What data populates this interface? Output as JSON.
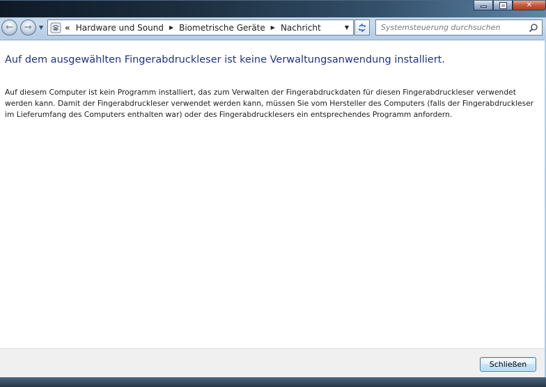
{
  "window": {
    "caption_buttons": {
      "minimize": "minimize",
      "maximize": "maximize",
      "close": "close"
    }
  },
  "navigation": {
    "back_icon": "back-arrow-icon",
    "forward_icon": "forward-arrow-icon",
    "overflow": "«",
    "breadcrumbs": [
      {
        "label": "Hardware und Sound"
      },
      {
        "label": "Biometrische Geräte"
      },
      {
        "label": "Nachricht"
      }
    ]
  },
  "search": {
    "placeholder": "Systemsteuerung durchsuchen",
    "value": ""
  },
  "content": {
    "heading": "Auf dem ausgewählten Fingerabdruckleser ist keine Verwaltungsanwendung installiert.",
    "description": "Auf diesem Computer ist kein Programm installiert, das zum Verwalten der Fingerabdruckdaten für diesen Fingerabdruckleser verwendet werden kann. Damit der Fingerabdruckleser verwendet werden kann, müssen Sie vom Hersteller des Computers (falls der Fingerabdruckleser im Lieferumfang des Computers enthalten war) oder des Fingerabdrucklesers ein entsprechendes Programm anfordern."
  },
  "footer": {
    "close_label": "Schließen"
  },
  "colors": {
    "heading": "#1e3287",
    "button_border": "#3c7fb1"
  }
}
